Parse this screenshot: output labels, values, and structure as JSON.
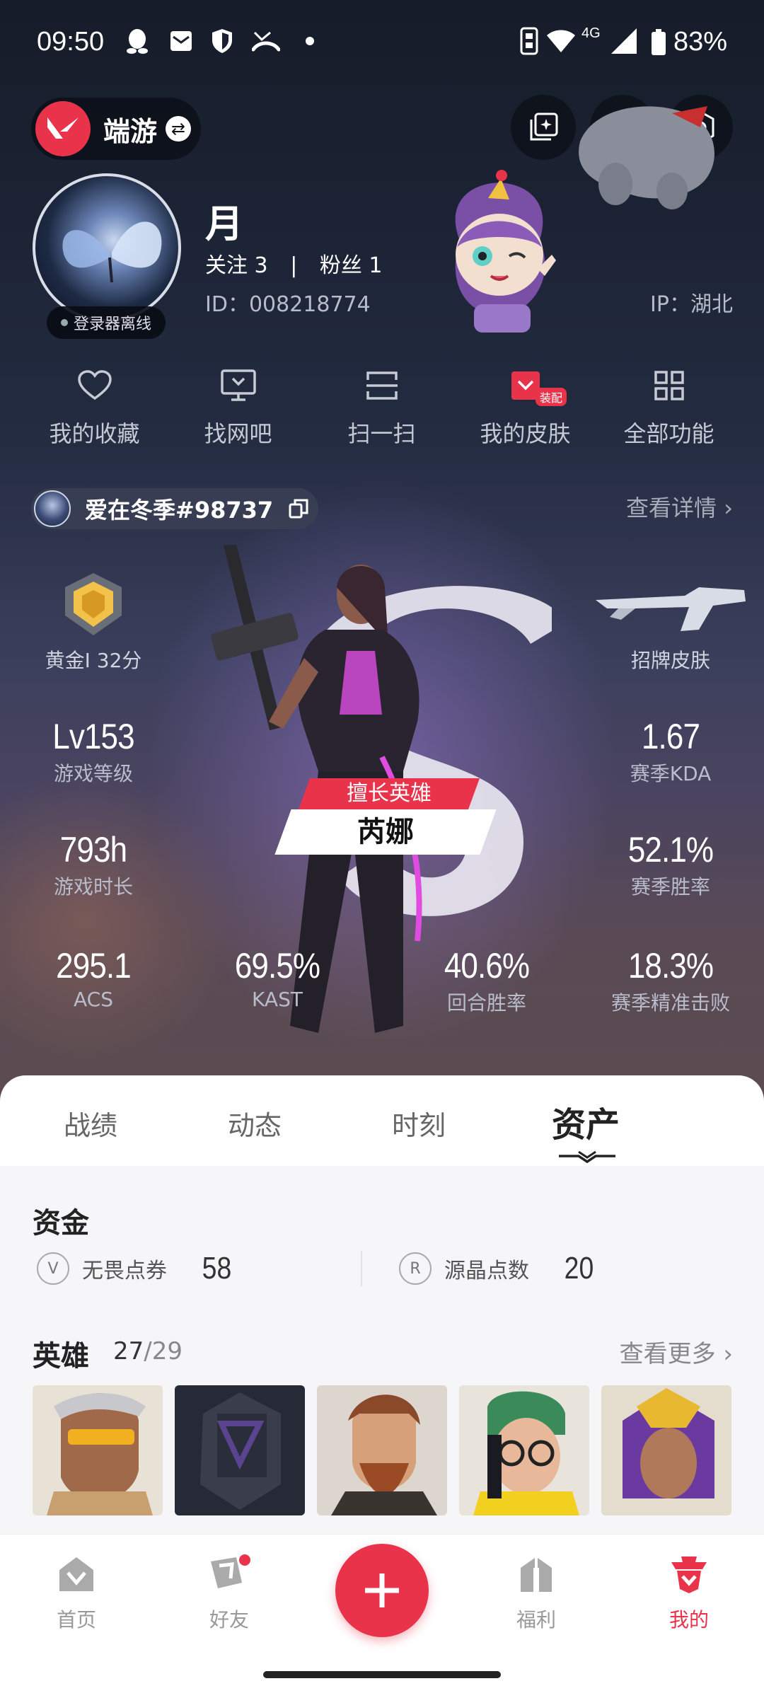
{
  "status_bar": {
    "time": "09:50",
    "battery": "83%",
    "network": "4G"
  },
  "header": {
    "game_name": "端游",
    "switch_icon": "swap-icon"
  },
  "profile": {
    "name": "月",
    "follow_label": "关注",
    "follow_count": "3",
    "fans_label": "粉丝",
    "fans_count": "1",
    "id_text": "ID：008218774",
    "ip_text": "IP：湖北",
    "status": "登录器离线"
  },
  "quick_menu": [
    {
      "label": "我的收藏",
      "icon": "heart-icon"
    },
    {
      "label": "找网吧",
      "icon": "monitor-icon"
    },
    {
      "label": "扫一扫",
      "icon": "scan-icon"
    },
    {
      "label": "我的皮肤",
      "icon": "skin-icon",
      "badge": "装配"
    },
    {
      "label": "全部功能",
      "icon": "grid-icon"
    }
  ],
  "account": {
    "name": "爱在冬季#98737",
    "detail_link": "查看详情"
  },
  "stats": {
    "rank": {
      "value": "黄金I 32分"
    },
    "signature_skin": {
      "label": "招牌皮肤"
    },
    "level": {
      "value": "Lv153",
      "label": "游戏等级"
    },
    "kda": {
      "value": "1.67",
      "label": "赛季KDA"
    },
    "hours": {
      "value": "793h",
      "label": "游戏时长"
    },
    "winrate": {
      "value": "52.1%",
      "label": "赛季胜率"
    },
    "acs": {
      "value": "295.1",
      "label": "ACS"
    },
    "kast": {
      "value": "69.5%",
      "label": "KAST"
    },
    "round_win": {
      "value": "40.6%",
      "label": "回合胜率"
    },
    "precise": {
      "value": "18.3%",
      "label": "赛季精准击败"
    }
  },
  "main_agent": {
    "tag": "擅长英雄",
    "name": "芮娜"
  },
  "tabs": [
    {
      "label": "战绩"
    },
    {
      "label": "动态"
    },
    {
      "label": "时刻"
    },
    {
      "label": "资产",
      "active": true
    }
  ],
  "funds": {
    "title": "资金",
    "items": [
      {
        "label": "无畏点券",
        "value": "58",
        "icon": "vp-coin-icon"
      },
      {
        "label": "源晶点数",
        "value": "20",
        "icon": "radianite-icon"
      }
    ]
  },
  "heroes": {
    "title": "英雄",
    "owned": "27",
    "total": "/29",
    "more": "查看更多",
    "portraits": [
      {
        "name": "agent-1",
        "bg": "#e8e2d6"
      },
      {
        "name": "agent-2",
        "bg": "#262a36"
      },
      {
        "name": "agent-3",
        "bg": "#dcd6cf"
      },
      {
        "name": "agent-4",
        "bg": "#e8e4dc"
      },
      {
        "name": "agent-5",
        "bg": "#e4dccd"
      }
    ]
  },
  "bottom_nav": [
    {
      "label": "首页",
      "icon": "home-icon"
    },
    {
      "label": "好友",
      "icon": "friends-icon"
    },
    {
      "label": "福利",
      "icon": "gift-icon"
    },
    {
      "label": "我的",
      "icon": "profile-icon",
      "active": true
    }
  ],
  "colors": {
    "accent": "#e8334a"
  }
}
